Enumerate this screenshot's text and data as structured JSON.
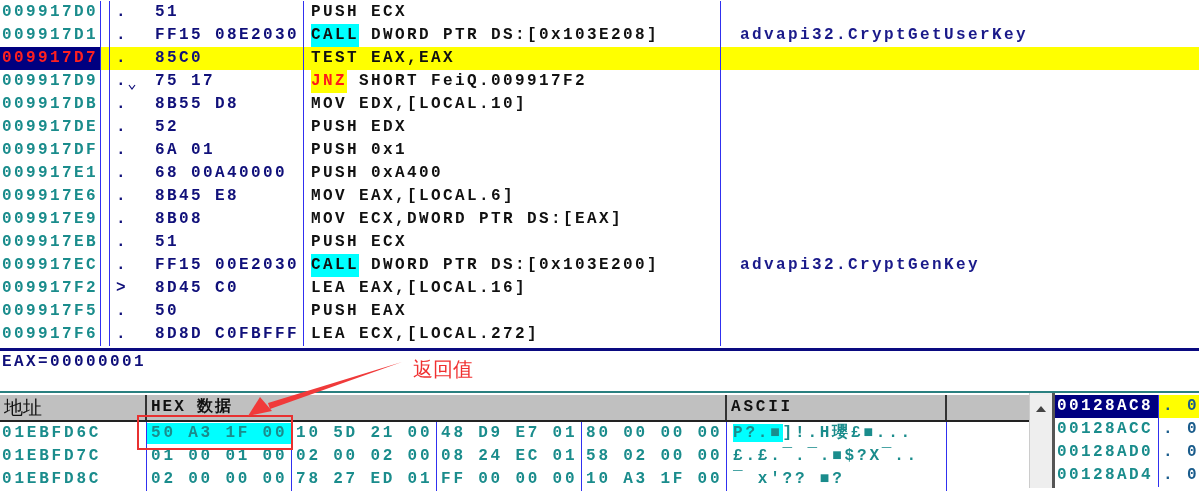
{
  "disassembly": {
    "rows": [
      {
        "address": "009917D0",
        "marker": ".",
        "jump_arrow": false,
        "hex": "51",
        "mnemonic": "PUSH",
        "kind": "plain",
        "operands": "ECX",
        "comment": "",
        "selected": false
      },
      {
        "address": "009917D1",
        "marker": ".",
        "jump_arrow": false,
        "hex": "FF15 08E2030",
        "mnemonic": "CALL",
        "kind": "call",
        "operands": "DWORD PTR DS:[0x103E208]",
        "comment": "advapi32.CryptGetUserKey",
        "selected": false
      },
      {
        "address": "009917D7",
        "marker": ".",
        "jump_arrow": false,
        "hex": "85C0",
        "mnemonic": "TEST",
        "kind": "plain",
        "operands": "EAX,EAX",
        "comment": "",
        "selected": true
      },
      {
        "address": "009917D9",
        "marker": ".",
        "jump_arrow": true,
        "hex": "75 17",
        "mnemonic": "JNZ",
        "kind": "jump",
        "operands": "SHORT FeiQ.009917F2",
        "comment": "",
        "selected": false
      },
      {
        "address": "009917DB",
        "marker": ".",
        "jump_arrow": false,
        "hex": "8B55 D8",
        "mnemonic": "MOV",
        "kind": "plain",
        "operands": "EDX,[LOCAL.10]",
        "comment": "",
        "selected": false
      },
      {
        "address": "009917DE",
        "marker": ".",
        "jump_arrow": false,
        "hex": "52",
        "mnemonic": "PUSH",
        "kind": "plain",
        "operands": "EDX",
        "comment": "",
        "selected": false
      },
      {
        "address": "009917DF",
        "marker": ".",
        "jump_arrow": false,
        "hex": "6A 01",
        "mnemonic": "PUSH",
        "kind": "plain",
        "operands": "0x1",
        "comment": "",
        "selected": false
      },
      {
        "address": "009917E1",
        "marker": ".",
        "jump_arrow": false,
        "hex": "68 00A40000",
        "mnemonic": "PUSH",
        "kind": "plain",
        "operands": "0xA400",
        "comment": "",
        "selected": false
      },
      {
        "address": "009917E6",
        "marker": ".",
        "jump_arrow": false,
        "hex": "8B45 E8",
        "mnemonic": "MOV",
        "kind": "plain",
        "operands": "EAX,[LOCAL.6]",
        "comment": "",
        "selected": false
      },
      {
        "address": "009917E9",
        "marker": ".",
        "jump_arrow": false,
        "hex": "8B08",
        "mnemonic": "MOV",
        "kind": "plain",
        "operands": "ECX,DWORD PTR DS:[EAX]",
        "comment": "",
        "selected": false
      },
      {
        "address": "009917EB",
        "marker": ".",
        "jump_arrow": false,
        "hex": "51",
        "mnemonic": "PUSH",
        "kind": "plain",
        "operands": "ECX",
        "comment": "",
        "selected": false
      },
      {
        "address": "009917EC",
        "marker": ".",
        "jump_arrow": false,
        "hex": "FF15 00E2030",
        "mnemonic": "CALL",
        "kind": "call",
        "operands": "DWORD PTR DS:[0x103E200]",
        "comment": "advapi32.CryptGenKey",
        "selected": false
      },
      {
        "address": "009917F2",
        "marker": ">",
        "jump_arrow": false,
        "hex": "8D45 C0",
        "mnemonic": "LEA",
        "kind": "plain",
        "operands": "EAX,[LOCAL.16]",
        "comment": "",
        "selected": false
      },
      {
        "address": "009917F5",
        "marker": ".",
        "jump_arrow": false,
        "hex": "50",
        "mnemonic": "PUSH",
        "kind": "plain",
        "operands": "EAX",
        "comment": "",
        "selected": false
      },
      {
        "address": "009917F6",
        "marker": ".",
        "jump_arrow": false,
        "hex": "8D8D C0FBFFF",
        "mnemonic": "LEA",
        "kind": "plain",
        "operands": "ECX,[LOCAL.272]",
        "comment": "",
        "selected": false
      }
    ]
  },
  "info": {
    "text": "EAX=00000001"
  },
  "annotation": {
    "label": "返回值"
  },
  "dump": {
    "columns": [
      "地址",
      "HEX 数据",
      "ASCII"
    ],
    "rows": [
      {
        "address": "01EBFD6C",
        "groups": [
          {
            "text": "50 A3 1F 00",
            "selected": true
          },
          {
            "text": "10 5D 21 00",
            "selected": false
          },
          {
            "text": "48 D9 E7 01",
            "selected": false
          },
          {
            "text": "80 00 00 00",
            "selected": false
          }
        ],
        "ascii": [
          {
            "text": "P?.■",
            "selected": true
          },
          {
            "text": "]!.H瓔£■...",
            "selected": false
          }
        ]
      },
      {
        "address": "01EBFD7C",
        "groups": [
          {
            "text": "01 00 01 00",
            "selected": false
          },
          {
            "text": "02 00 02 00",
            "selected": false
          },
          {
            "text": "08 24 EC 01",
            "selected": false
          },
          {
            "text": "58 02 00 00",
            "selected": false
          }
        ],
        "ascii": [
          {
            "text": "£.£.¯.¯.■$?X¯..",
            "selected": false
          }
        ]
      },
      {
        "address": "01EBFD8C",
        "groups": [
          {
            "text": "02 00 00 00",
            "selected": false
          },
          {
            "text": "78 27 ED 01",
            "selected": false
          },
          {
            "text": "FF 00 00 00",
            "selected": false
          },
          {
            "text": "10 A3 1F 00",
            "selected": false
          }
        ],
        "ascii": [
          {
            "text": "¯  x'??  ■?",
            "selected": false
          }
        ]
      }
    ]
  },
  "stack": {
    "rows": [
      {
        "address": "00128AC8",
        "value": ". 0",
        "selected": true
      },
      {
        "address": "00128ACC",
        "value": ". 0",
        "selected": false
      },
      {
        "address": "00128AD0",
        "value": ". 0",
        "selected": false
      },
      {
        "address": "00128AD4",
        "value": ". 0",
        "selected": false
      }
    ]
  }
}
